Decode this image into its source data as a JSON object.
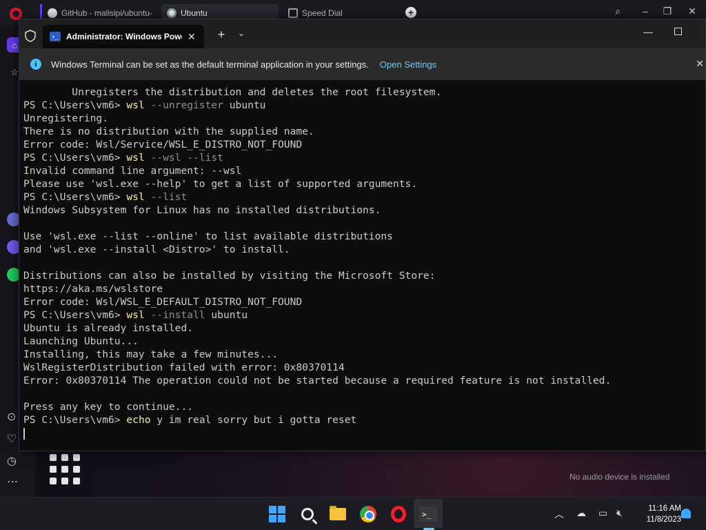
{
  "browser": {
    "tabs": [
      {
        "label": "GitHub - malisipi/ubuntu-",
        "icon": "github-icon"
      },
      {
        "label": "Ubuntu",
        "icon": "ubuntu-icon"
      },
      {
        "label": "Speed Dial",
        "icon": "speed-dial-icon"
      }
    ],
    "audio_note": "No audio device is installed"
  },
  "terminal": {
    "tab_title": "Administrator: Windows PowerShell",
    "infobar": {
      "message": "Windows Terminal can be set as the default terminal application in your settings.",
      "link": "Open Settings"
    },
    "lines": [
      {
        "text": "        Unregisters the distribution and deletes the root filesystem."
      },
      {
        "prompt": "PS C:\\Users\\vm6> ",
        "cmd": "wsl",
        "args": " --unregister",
        "rest": " ubuntu"
      },
      {
        "text": "Unregistering."
      },
      {
        "text": "There is no distribution with the supplied name."
      },
      {
        "text": "Error code: Wsl/Service/WSL_E_DISTRO_NOT_FOUND"
      },
      {
        "prompt": "PS C:\\Users\\vm6> ",
        "cmd": "wsl",
        "args": " --wsl --list",
        "rest": ""
      },
      {
        "text": "Invalid command line argument: --wsl"
      },
      {
        "text": "Please use 'wsl.exe --help' to get a list of supported arguments."
      },
      {
        "prompt": "PS C:\\Users\\vm6> ",
        "cmd": "wsl",
        "args": " --list",
        "rest": ""
      },
      {
        "text": "Windows Subsystem for Linux has no installed distributions."
      },
      {
        "text": ""
      },
      {
        "text": "Use 'wsl.exe --list --online' to list available distributions"
      },
      {
        "text": "and 'wsl.exe --install <Distro>' to install."
      },
      {
        "text": ""
      },
      {
        "text": "Distributions can also be installed by visiting the Microsoft Store:"
      },
      {
        "text": "https://aka.ms/wslstore"
      },
      {
        "text": "Error code: Wsl/WSL_E_DEFAULT_DISTRO_NOT_FOUND"
      },
      {
        "prompt": "PS C:\\Users\\vm6> ",
        "cmd": "wsl",
        "args": " --install",
        "rest": " ubuntu"
      },
      {
        "text": "Ubuntu is already installed."
      },
      {
        "text": "Launching Ubuntu..."
      },
      {
        "text": "Installing, this may take a few minutes..."
      },
      {
        "text": "WslRegisterDistribution failed with error: 0x80370114"
      },
      {
        "text": "Error: 0x80370114 The operation could not be started because a required feature is not installed."
      },
      {
        "text": ""
      },
      {
        "text": "Press any key to continue..."
      },
      {
        "prompt": "PS C:\\Users\\vm6> ",
        "cmd": "echo",
        "args": "",
        "rest": " y im real sorry but i gotta reset"
      }
    ]
  },
  "taskbar": {
    "time": "11:16 AM",
    "date": "11/8/2023",
    "apps": [
      "windows-start",
      "search",
      "file-explorer",
      "chrome",
      "opera",
      "terminal"
    ]
  },
  "colors": {
    "accent": "#60cdff",
    "command": "#f9f1a5",
    "argument": "#8f8f8f",
    "terminal_bg": "#0c0c0c"
  }
}
